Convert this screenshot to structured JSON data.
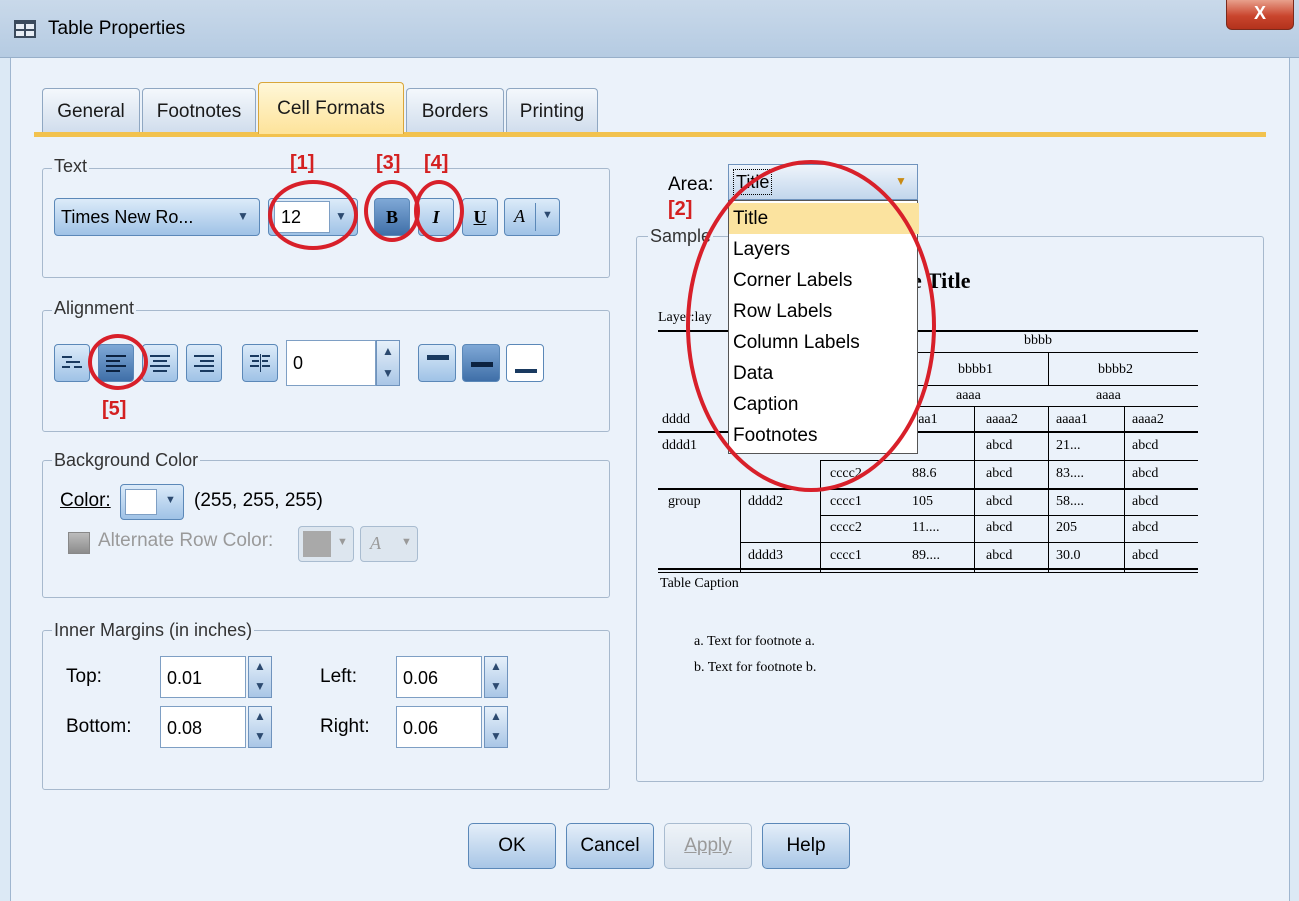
{
  "window": {
    "title": "Table Properties",
    "close_label": "X"
  },
  "tabs": [
    "General",
    "Footnotes",
    "Cell Formats",
    "Borders",
    "Printing"
  ],
  "text_group": {
    "label": "Text",
    "font": "Times New Ro...",
    "size": "12",
    "bold": "B",
    "italic": "I",
    "underline": "U",
    "color_letter": "A"
  },
  "alignment_group": {
    "label": "Alignment",
    "decimal_offset": "0"
  },
  "background_group": {
    "label": "Background Color",
    "color_label": "Color:",
    "color_value": "(255, 255, 255)",
    "alternate_label": "Alternate Row Color:",
    "alternate_letter": "A"
  },
  "margins_group": {
    "label": "Inner Margins (in inches)",
    "top_label": "Top:",
    "top": "0.01",
    "bottom_label": "Bottom:",
    "bottom": "0.08",
    "left_label": "Left:",
    "left": "0.06",
    "right_label": "Right:",
    "right": "0.06"
  },
  "area": {
    "label": "Area:",
    "selected": "Title",
    "options": [
      "Title",
      "Layers",
      "Corner Labels",
      "Row Labels",
      "Column Labels",
      "Data",
      "Caption",
      "Footnotes"
    ]
  },
  "sample": {
    "label": "Sample",
    "title_fragment": "e Title",
    "layer": "Layer:lay",
    "col_top": "bbbb",
    "col_b1": "bbbb1",
    "col_b2": "bbbb2",
    "aaaa_1": "aaaa",
    "aaaa_2": "aaaa",
    "corner": "dddd",
    "h_a1": "aaa1",
    "h_a2": "aaaa2",
    "h_a3": "aaaa1",
    "h_a4": "aaaa2",
    "rows": [
      {
        "c1": "dddd1",
        "c2": "",
        "c3": "",
        "c4": "",
        "c5": "abcd",
        "c6": "21...",
        "c7": "abcd"
      },
      {
        "c1": "",
        "c2": "",
        "c3": "cccc2",
        "c4": "88.6",
        "c5": "abcd",
        "c6": "83....",
        "c7": "abcd"
      },
      {
        "c1": "group",
        "c2": "dddd2",
        "c3": "cccc1",
        "c4": "105",
        "c5": "abcd",
        "c6": "58....",
        "c7": "abcd"
      },
      {
        "c1": "",
        "c2": "",
        "c3": "cccc2",
        "c4": "11....",
        "c5": "abcd",
        "c6": "205",
        "c7": "abcd"
      },
      {
        "c1": "",
        "c2": "dddd3",
        "c3": "cccc1",
        "c4": "89....",
        "c5": "abcd",
        "c6": "30.0",
        "c7": "abcd"
      }
    ],
    "caption": "Table Caption",
    "footnote_a": "a. Text for footnote a.",
    "footnote_b": "b. Text for footnote b."
  },
  "annotations": {
    "n1": "[1]",
    "n2": "[2]",
    "n3": "[3]",
    "n4": "[4]",
    "n5": "[5]"
  },
  "buttons": {
    "ok": "OK",
    "cancel": "Cancel",
    "apply": "Apply",
    "help": "Help"
  }
}
